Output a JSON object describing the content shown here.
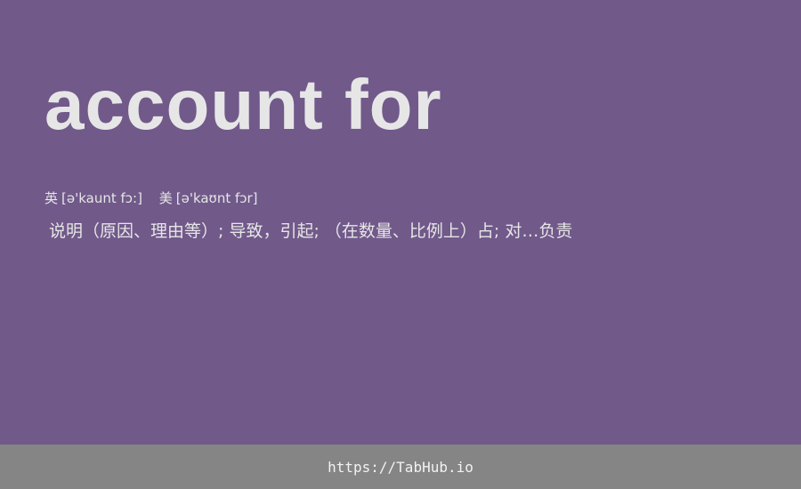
{
  "card": {
    "headword": "account for",
    "pronunciations": {
      "uk": {
        "region": "英",
        "ipa": "[ə'kaunt fɔ:]"
      },
      "us": {
        "region": "美",
        "ipa": "[ə'kaʊnt fɔr]"
      }
    },
    "definition": "说明（原因、理由等）; 导致，引起; （在数量、比例上）占; 对…负责"
  },
  "footer": {
    "link_text": "https://TabHub.io"
  },
  "colors": {
    "background": "#71598a",
    "text": "#e6e6e6",
    "footer_bar": "#858585",
    "footer_text": "#f2f2f2"
  }
}
